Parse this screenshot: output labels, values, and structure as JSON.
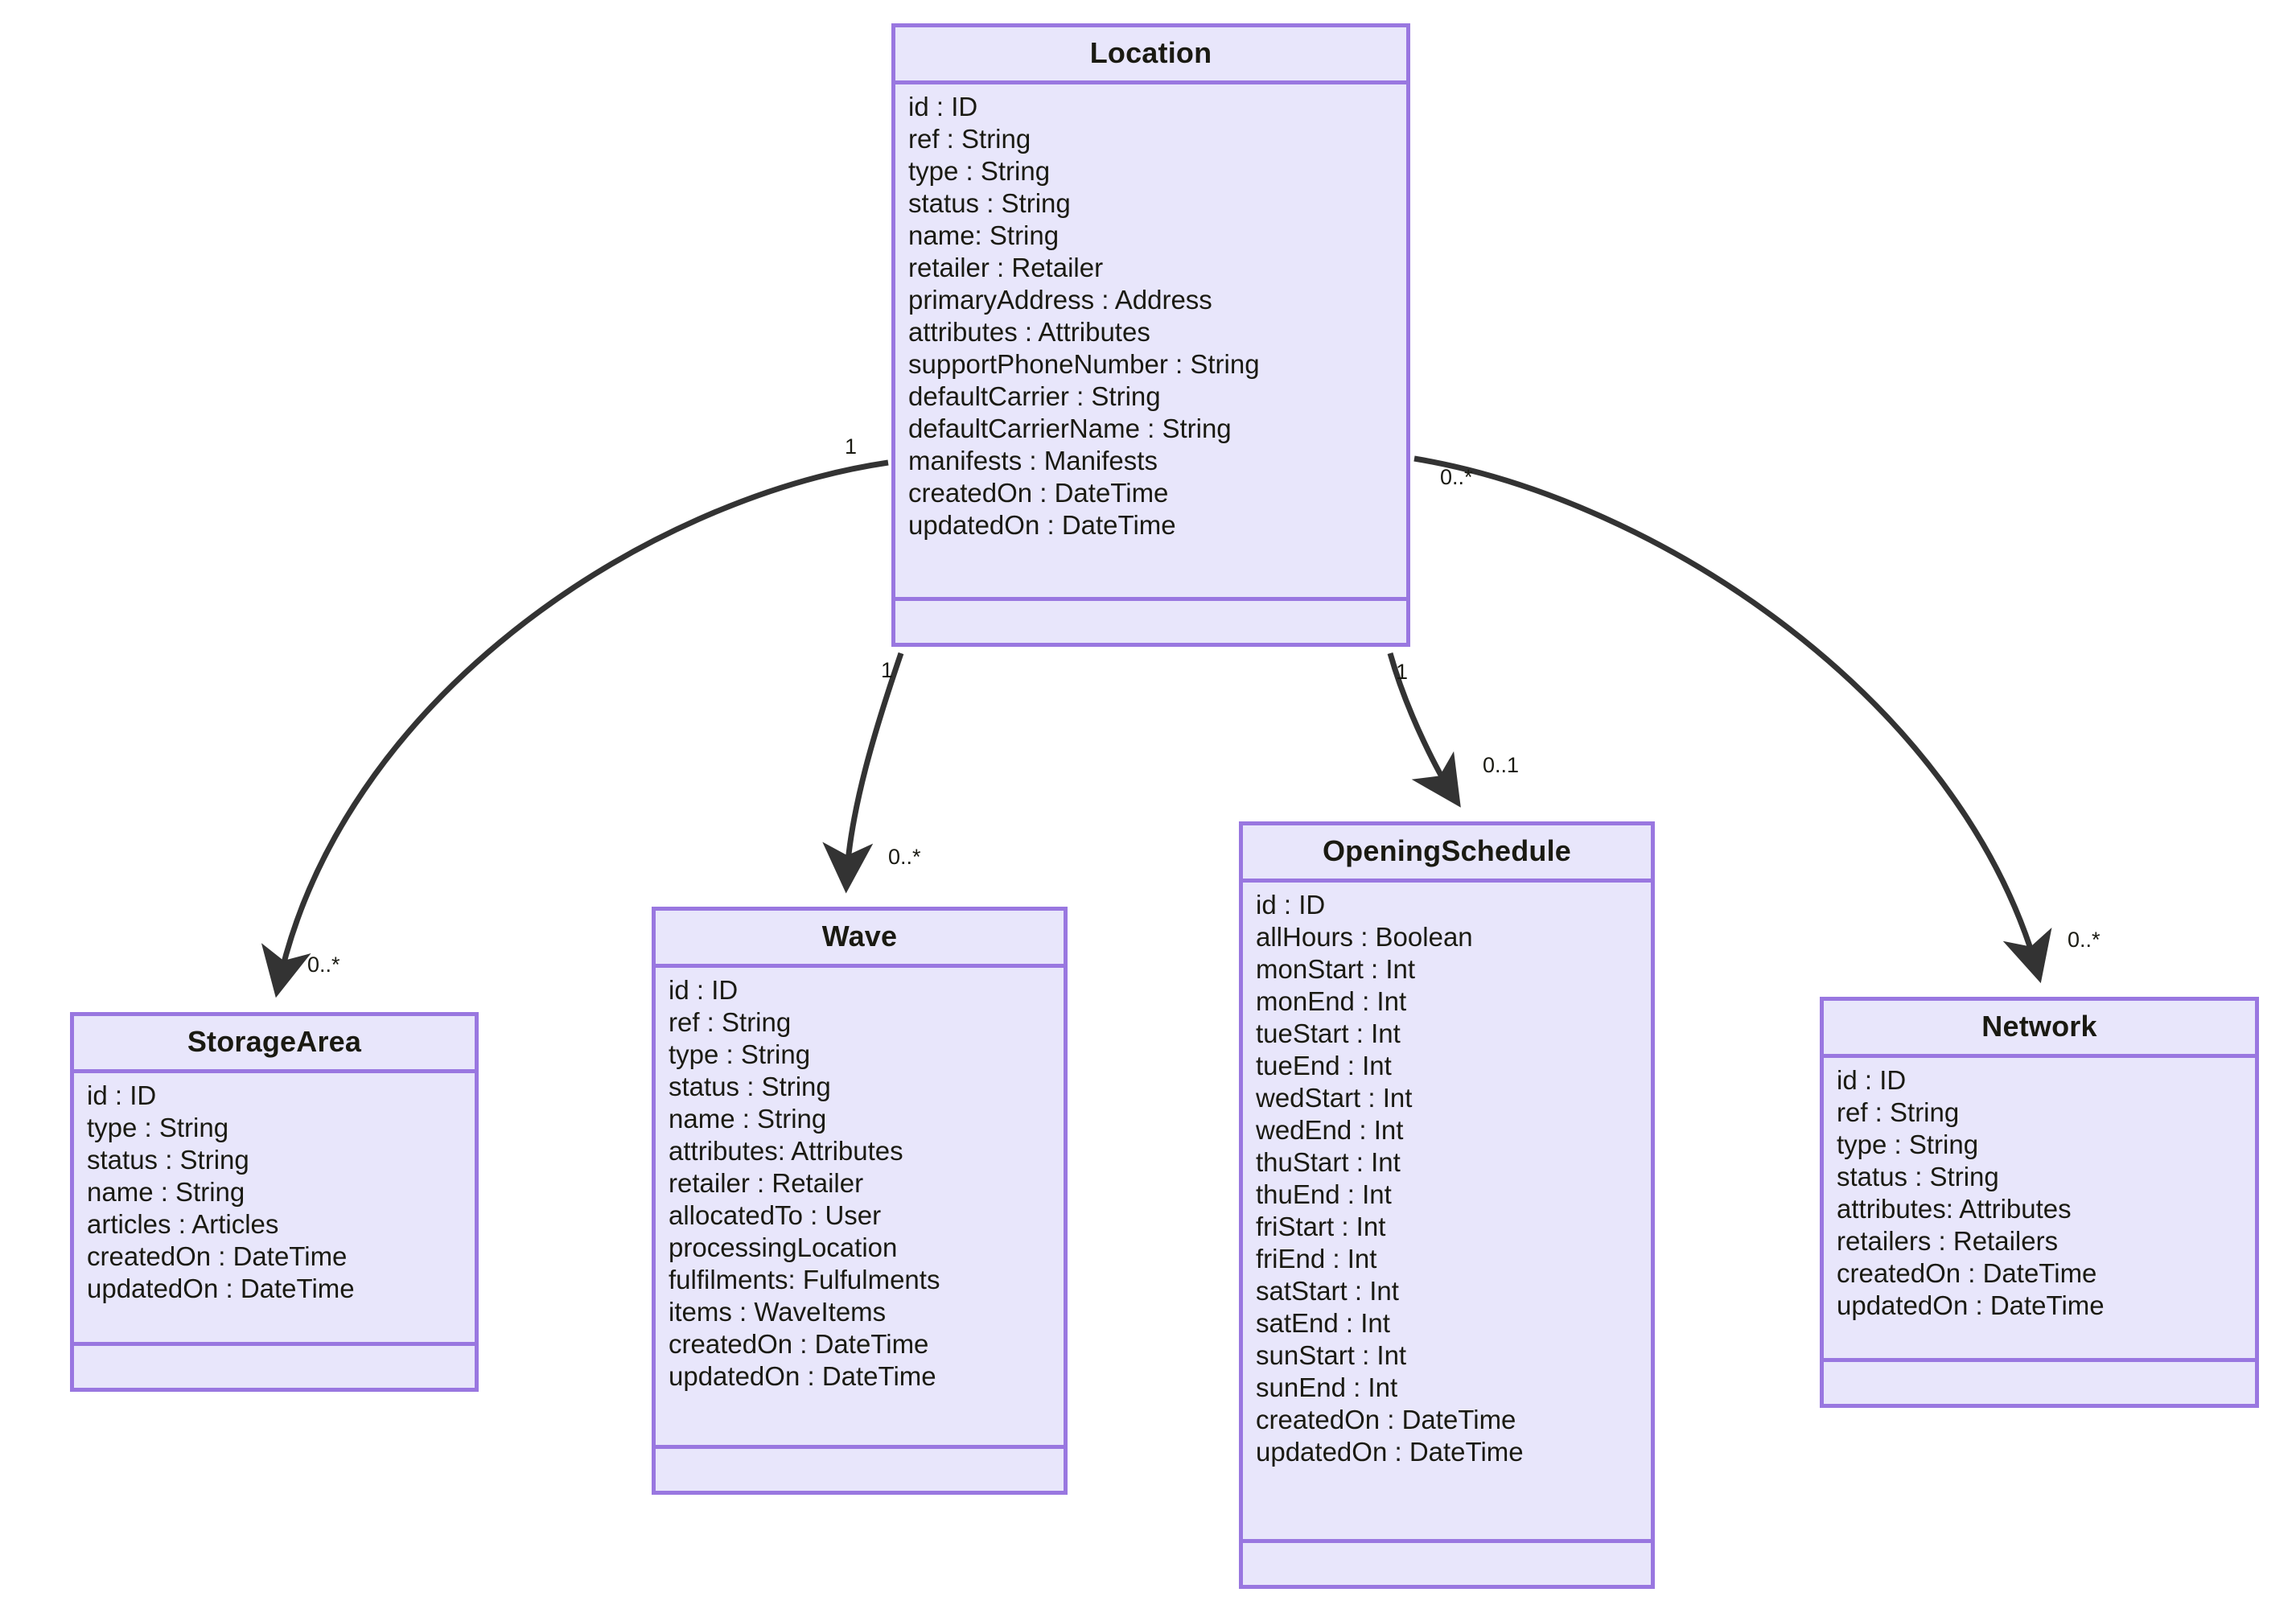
{
  "diagram": {
    "kind": "uml-class-diagram",
    "colors": {
      "class_fill": "#e8e6fb",
      "class_border": "#9977e0",
      "edge": "#333333",
      "text": "#1a1a12",
      "background": "#ffffff"
    }
  },
  "classes": {
    "location": {
      "name": "Location",
      "attributes": [
        "id : ID",
        "ref : String",
        "type : String",
        "status : String",
        "name: String",
        "retailer : Retailer",
        "primaryAddress : Address",
        "attributes : Attributes",
        "supportPhoneNumber : String",
        "defaultCarrier : String",
        "defaultCarrierName : String",
        "manifests : Manifests",
        "createdOn : DateTime",
        "updatedOn : DateTime"
      ],
      "methods": []
    },
    "storage_area": {
      "name": "StorageArea",
      "attributes": [
        "id : ID",
        "type : String",
        "status : String",
        "name : String",
        "articles : Articles",
        "createdOn : DateTime",
        "updatedOn : DateTime"
      ],
      "methods": []
    },
    "wave": {
      "name": "Wave",
      "attributes": [
        "id : ID",
        "ref : String",
        "type : String",
        "status : String",
        "name : String",
        "attributes: Attributes",
        "retailer : Retailer",
        "allocatedTo : User",
        "processingLocation",
        "fulfilments: Fulfulments",
        "items : WaveItems",
        "createdOn : DateTime",
        "updatedOn : DateTime"
      ],
      "methods": []
    },
    "opening_schedule": {
      "name": "OpeningSchedule",
      "attributes": [
        "id : ID",
        "allHours : Boolean",
        "monStart : Int",
        "monEnd : Int",
        "tueStart : Int",
        "tueEnd : Int",
        "wedStart : Int",
        "wedEnd : Int",
        "thuStart : Int",
        "thuEnd : Int",
        "friStart : Int",
        "friEnd : Int",
        "satStart : Int",
        "satEnd : Int",
        "sunStart : Int",
        "sunEnd : Int",
        "createdOn : DateTime",
        "updatedOn : DateTime"
      ],
      "methods": []
    },
    "network": {
      "name": "Network",
      "attributes": [
        "id : ID",
        "ref : String",
        "type : String",
        "status : String",
        "attributes: Attributes",
        "retailers : Retailers",
        "createdOn : DateTime",
        "updatedOn : DateTime"
      ],
      "methods": []
    }
  },
  "relationships": [
    {
      "from": "Location",
      "to": "StorageArea",
      "source_multiplicity": "1",
      "target_multiplicity": "0..*"
    },
    {
      "from": "Location",
      "to": "Wave",
      "source_multiplicity": "1",
      "target_multiplicity": "0..*"
    },
    {
      "from": "Location",
      "to": "OpeningSchedule",
      "source_multiplicity": "1",
      "target_multiplicity": "0..1"
    },
    {
      "from": "Location",
      "to": "Network",
      "source_multiplicity": "0..*",
      "target_multiplicity": "0..*"
    }
  ]
}
